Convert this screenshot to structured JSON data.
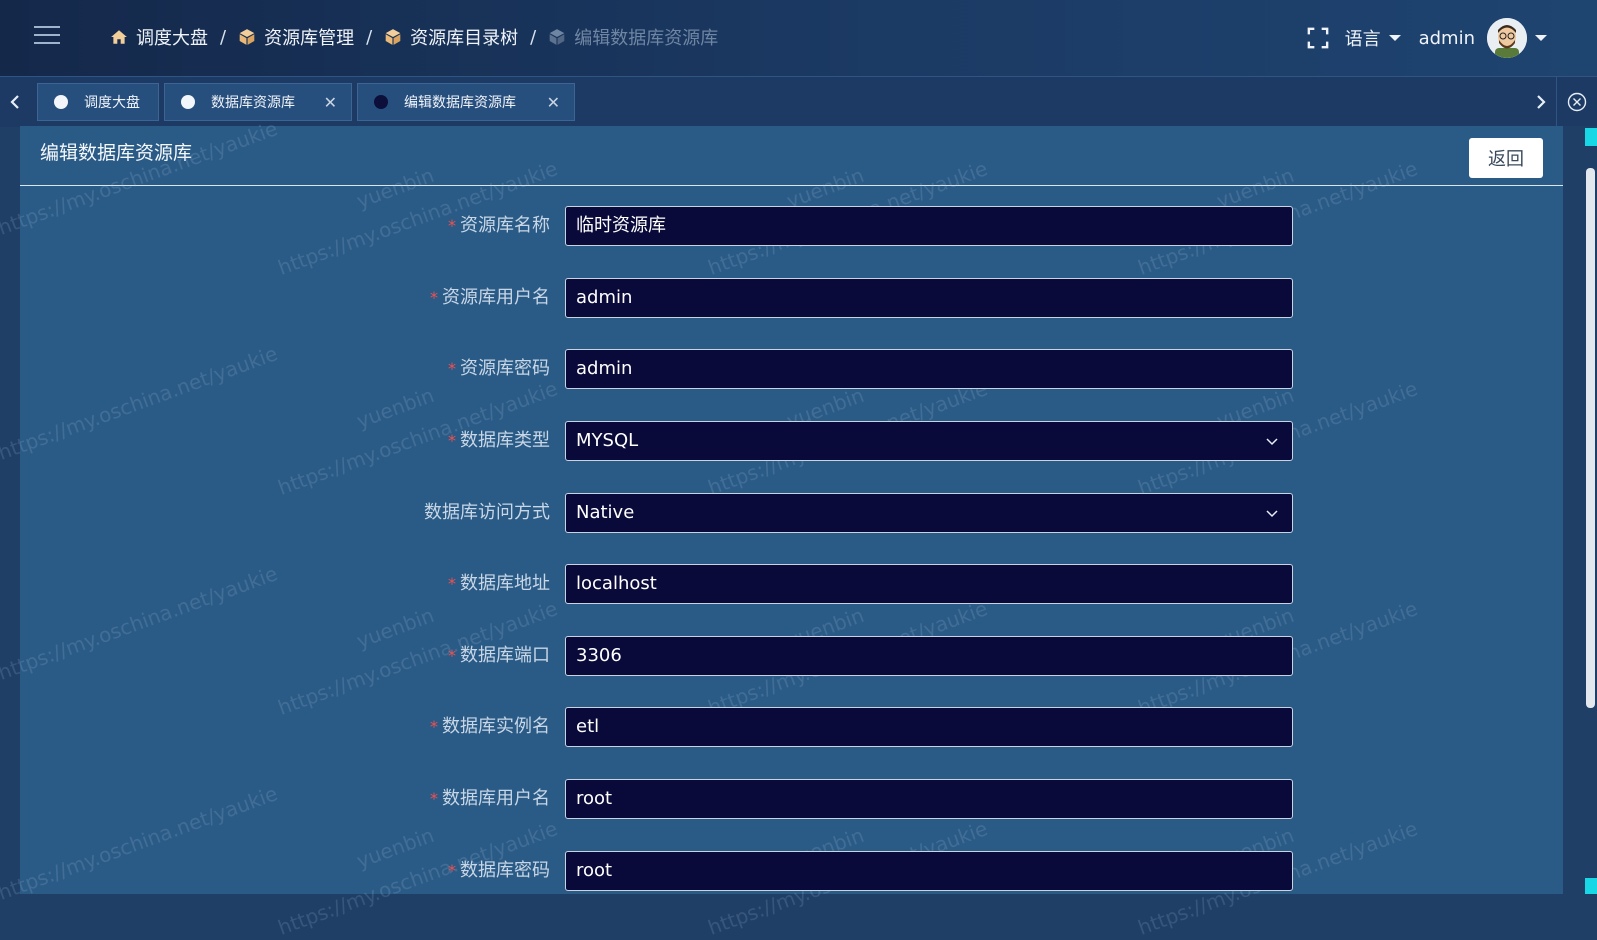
{
  "header": {
    "breadcrumb": [
      {
        "label": "调度大盘",
        "icon": "home-icon"
      },
      {
        "label": "资源库管理",
        "icon": "cube-icon"
      },
      {
        "label": "资源库目录树",
        "icon": "cube-icon"
      },
      {
        "label": "编辑数据库资源库",
        "icon": "cube-icon"
      }
    ],
    "separator": "/",
    "language_label": "语言",
    "username": "admin"
  },
  "tabs": [
    {
      "label": "调度大盘"
    },
    {
      "label": "数据库资源库",
      "close": "✕"
    },
    {
      "label": "编辑数据库资源库",
      "close": "✕"
    }
  ],
  "panel": {
    "title": "编辑数据库资源库",
    "back_label": "返回"
  },
  "form": {
    "fields": [
      {
        "label": "资源库名称",
        "required": true,
        "value": "临时资源库",
        "type": "text"
      },
      {
        "label": "资源库用户名",
        "required": true,
        "value": "admin",
        "type": "text"
      },
      {
        "label": "资源库密码",
        "required": true,
        "value": "admin",
        "type": "text"
      },
      {
        "label": "数据库类型",
        "required": true,
        "value": "MYSQL",
        "type": "select"
      },
      {
        "label": "数据库访问方式",
        "required": false,
        "value": "Native",
        "type": "select"
      },
      {
        "label": "数据库地址",
        "required": true,
        "value": "localhost",
        "type": "text"
      },
      {
        "label": "数据库端口",
        "required": true,
        "value": "3306",
        "type": "text"
      },
      {
        "label": "数据库实例名",
        "required": true,
        "value": "etl",
        "type": "text"
      },
      {
        "label": "数据库用户名",
        "required": true,
        "value": "root",
        "type": "text"
      },
      {
        "label": "数据库密码",
        "required": true,
        "value": "root",
        "type": "text"
      }
    ],
    "required_mark": "*"
  },
  "watermark": {
    "line1": "yuenbin",
    "line2": "https://my.oschina.net/yaukie"
  },
  "colors": {
    "header_bg": "#14284a",
    "panel_bg": "#2a5b86",
    "input_bg": "#0a0a3a",
    "required": "#f05050",
    "accent": "#18d8e6"
  }
}
